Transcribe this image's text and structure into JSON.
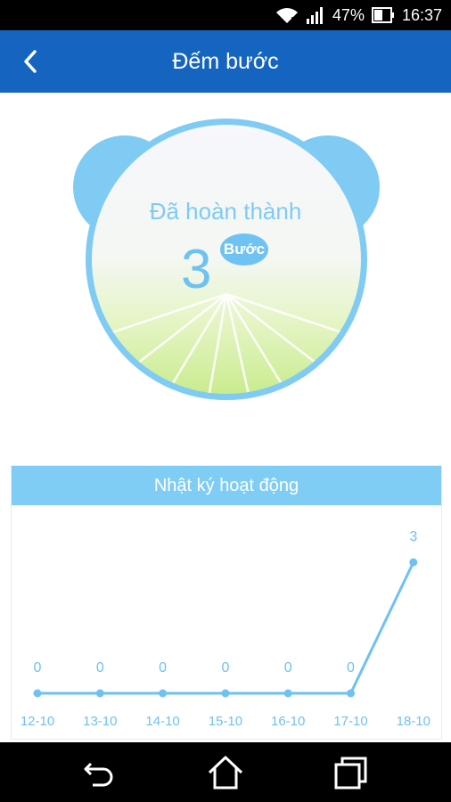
{
  "status_bar": {
    "battery": "47%",
    "time": "16:37",
    "icons": [
      "wifi-icon",
      "signal-icon",
      "battery-icon"
    ]
  },
  "app_bar": {
    "title": "Đếm bước",
    "back_icon": "chevron-left-icon"
  },
  "progress": {
    "title": "Đã hoàn thành",
    "count": "3",
    "unit": "Bước"
  },
  "activity_log": {
    "title": "Nhật ký hoạt động",
    "chart_data": {
      "type": "line",
      "categories": [
        "12-10",
        "13-10",
        "14-10",
        "15-10",
        "16-10",
        "17-10",
        "18-10"
      ],
      "values": [
        0,
        0,
        0,
        0,
        0,
        0,
        3
      ],
      "ylim": [
        0,
        3
      ],
      "grid": false,
      "color": "#6ec2f1"
    }
  },
  "nav_bar": {
    "buttons": [
      "back-arrow-icon",
      "home-icon",
      "recent-apps-icon"
    ]
  },
  "colors": {
    "app_bar": "#1565c0",
    "accent": "#7fcbf3",
    "panel_header": "#7fcdf5"
  }
}
